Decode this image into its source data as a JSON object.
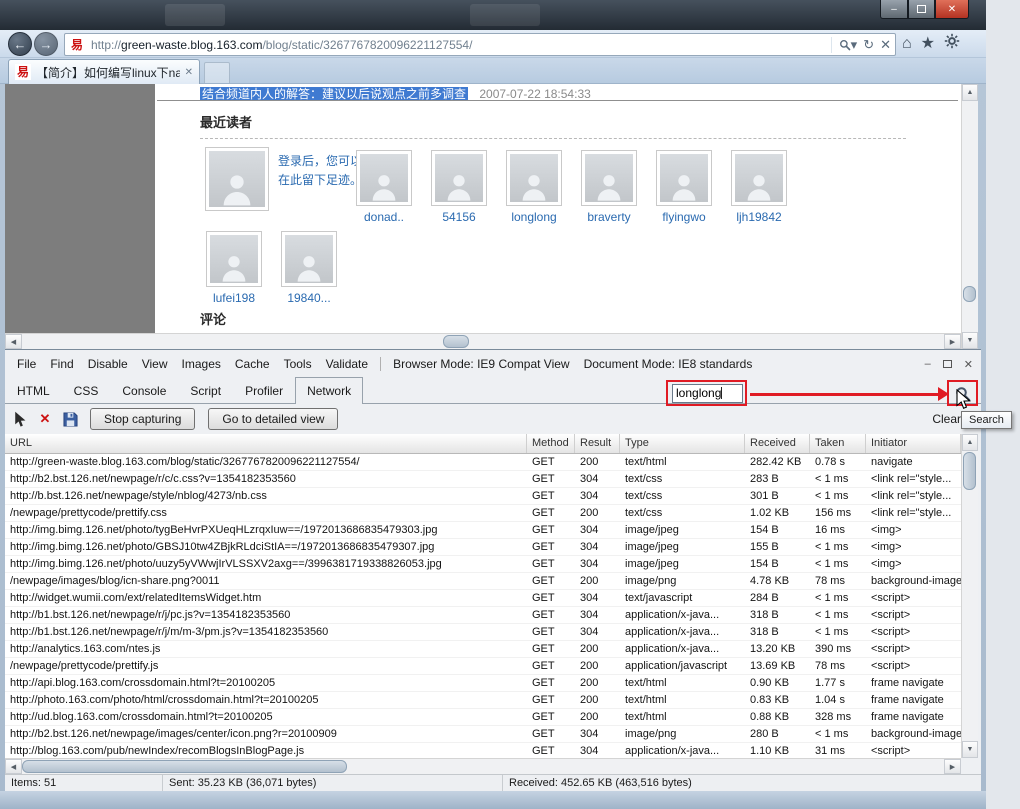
{
  "colors": {
    "annotation_red": "#e01b24",
    "link_blue": "#2a6ab0",
    "selection_blue": "#3f7ad1"
  },
  "icons": {
    "back": "←",
    "forward": "→",
    "dropdown_small": "▾",
    "refresh": "↻",
    "stop": "✕",
    "home": "⌂",
    "favorites": "★",
    "minimize": "–",
    "close": "✕",
    "tab_close": "✕",
    "scroll_up": "▲",
    "scroll_down": "▼",
    "scroll_left": "◀",
    "scroll_right": "▶",
    "clear_x": "✕",
    "menu_minimize": "–",
    "menu_close": "✕"
  },
  "browser_chrome": {
    "favicon_char": "易",
    "url_prefix": "http://",
    "url_domain": "green-waste.blog.163.com",
    "url_path": "/blog/static/3267767820096221127554/",
    "tab_title": "【简介】如何编写linux下na..."
  },
  "blog": {
    "highlighted_text": "结合频道内人的解答：建议以后说观点之前多调查",
    "highlight_date": "2007-07-22 18:54:33",
    "recent_readers_heading": "最近读者",
    "login_hint_line1": "登录后，您可以",
    "login_hint_line2": "在此留下足迹。",
    "readers_row1": [
      "donad..",
      "54156",
      "longlong",
      "braverty",
      "flyingwo",
      "ljh19842"
    ],
    "readers_row2": [
      "lufei198",
      "19840..."
    ],
    "comments_heading": "评论"
  },
  "devtools": {
    "menu_items": [
      "File",
      "Find",
      "Disable",
      "View",
      "Images",
      "Cache",
      "Tools",
      "Validate"
    ],
    "browser_mode_label": "Browser Mode: IE9 Compat View",
    "document_mode_label": "Document Mode: IE8 standards",
    "tabs": [
      "HTML",
      "CSS",
      "Console",
      "Script",
      "Profiler",
      "Network"
    ],
    "active_tab": "Network",
    "search_input_value": "longlong",
    "toolbar": {
      "stop_capturing_label": "Stop capturing",
      "detailed_view_label": "Go to detailed view",
      "clear_label": "Clear",
      "search_tooltip": "Search"
    },
    "network_table": {
      "headers": [
        "URL",
        "Method",
        "Result",
        "Type",
        "Received",
        "Taken",
        "Initiator"
      ],
      "rows": [
        [
          "http://green-waste.blog.163.com/blog/static/3267767820096221127554/",
          "GET",
          "200",
          "text/html",
          "282.42 KB",
          "0.78 s",
          "navigate"
        ],
        [
          "http://b2.bst.126.net/newpage/r/c/c.css?v=1354182353560",
          "GET",
          "304",
          "text/css",
          "283 B",
          "< 1 ms",
          "<link rel=\"style..."
        ],
        [
          "http://b.bst.126.net/newpage/style/nblog/4273/nb.css",
          "GET",
          "304",
          "text/css",
          "301 B",
          "< 1 ms",
          "<link rel=\"style..."
        ],
        [
          "/newpage/prettycode/prettify.css",
          "GET",
          "200",
          "text/css",
          "1.02 KB",
          "156 ms",
          "<link rel=\"style..."
        ],
        [
          "http://img.bimg.126.net/photo/tygBeHvrPXUeqHLzrqxIuw==/1972013686835479303.jpg",
          "GET",
          "304",
          "image/jpeg",
          "154 B",
          "16 ms",
          "<img>"
        ],
        [
          "http://img.bimg.126.net/photo/GBSJ10tw4ZBjkRLdciStIA==/1972013686835479307.jpg",
          "GET",
          "304",
          "image/jpeg",
          "155 B",
          "< 1 ms",
          "<img>"
        ],
        [
          "http://img.bimg.126.net/photo/uuzy5yVWwjIrVLSSXV2axg==/3996381719338826053.jpg",
          "GET",
          "304",
          "image/jpeg",
          "154 B",
          "< 1 ms",
          "<img>"
        ],
        [
          "/newpage/images/blog/icn-share.png?0011",
          "GET",
          "200",
          "image/png",
          "4.78 KB",
          "78 ms",
          "background-image"
        ],
        [
          "http://widget.wumii.com/ext/relatedItemsWidget.htm",
          "GET",
          "304",
          "text/javascript",
          "284 B",
          "< 1 ms",
          "<script>"
        ],
        [
          "http://b1.bst.126.net/newpage/r/j/pc.js?v=1354182353560",
          "GET",
          "304",
          "application/x-java...",
          "318 B",
          "< 1 ms",
          "<script>"
        ],
        [
          "http://b1.bst.126.net/newpage/r/j/m/m-3/pm.js?v=1354182353560",
          "GET",
          "304",
          "application/x-java...",
          "318 B",
          "< 1 ms",
          "<script>"
        ],
        [
          "http://analytics.163.com/ntes.js",
          "GET",
          "200",
          "application/x-java...",
          "13.20 KB",
          "390 ms",
          "<script>"
        ],
        [
          "/newpage/prettycode/prettify.js",
          "GET",
          "200",
          "application/javascript",
          "13.69 KB",
          "78 ms",
          "<script>"
        ],
        [
          "http://api.blog.163.com/crossdomain.html?t=20100205",
          "GET",
          "200",
          "text/html",
          "0.90 KB",
          "1.77 s",
          "frame navigate"
        ],
        [
          "http://photo.163.com/photo/html/crossdomain.html?t=20100205",
          "GET",
          "200",
          "text/html",
          "0.83 KB",
          "1.04 s",
          "frame navigate"
        ],
        [
          "http://ud.blog.163.com/crossdomain.html?t=20100205",
          "GET",
          "200",
          "text/html",
          "0.88 KB",
          "328 ms",
          "frame navigate"
        ],
        [
          "http://b2.bst.126.net/newpage/images/center/icon.png?r=20100909",
          "GET",
          "304",
          "image/png",
          "280 B",
          "< 1 ms",
          "background-image"
        ],
        [
          "http://blog.163.com/pub/newIndex/recomBlogsInBlogPage.js",
          "GET",
          "304",
          "application/x-java...",
          "1.10 KB",
          "31 ms",
          "<script>"
        ]
      ]
    },
    "status_bar": {
      "items": "Items: 51",
      "sent": "Sent: 35.23 KB (36,071 bytes)",
      "received": "Received: 452.65 KB (463,516 bytes)"
    }
  }
}
